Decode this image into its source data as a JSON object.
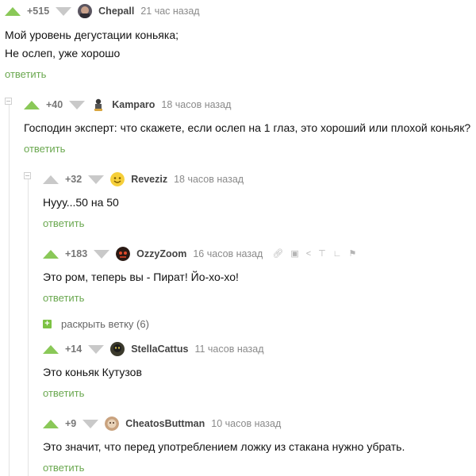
{
  "comments": [
    {
      "rating": "+515",
      "username": "Chepall",
      "time": "21 час назад",
      "text": [
        "Мой уровень дегустации коньяка;",
        "Не ослеп, уже хорошо"
      ],
      "reply": "ответить"
    },
    {
      "rating": "+40",
      "username": "Kamparo",
      "time": "18 часов назад",
      "text": [
        "Господин эксперт: что скажете, если ослеп на 1 глаз, это хороший или плохой коньяк?"
      ],
      "reply": "ответить"
    },
    {
      "rating": "+32",
      "username": "Reveziz",
      "time": "18 часов назад",
      "text": [
        "Нууу...50 на 50"
      ],
      "reply": "ответить"
    },
    {
      "rating": "+183",
      "username": "OzzyZoom",
      "time": "16 часов назад",
      "text": [
        "Это ром, теперь вы - Пират! Йо-хо-хо!"
      ],
      "reply": "ответить"
    },
    {
      "rating": "+14",
      "username": "StellaCattus",
      "time": "11 часов назад",
      "text": [
        "Это коньяк Кутузов"
      ],
      "reply": "ответить"
    },
    {
      "rating": "+9",
      "username": "CheatosButtman",
      "time": "10 часов назад",
      "text": [
        "Это значит, что перед употреблением ложку из стакана нужно убрать."
      ],
      "reply": "ответить"
    }
  ],
  "expand_branch": {
    "label": "раскрыть ветку (6)"
  },
  "icons": {
    "vote_up": "triangle-up-icon",
    "vote_down": "triangle-down-icon",
    "tools": [
      "link-icon",
      "save-icon",
      "share-icon",
      "pin-icon",
      "flag-small-icon",
      "report-flag-icon"
    ]
  },
  "colors": {
    "accent_green": "#8ac858",
    "reply_link": "#6aa84f",
    "muted_arrow": "#c9c9c9"
  }
}
